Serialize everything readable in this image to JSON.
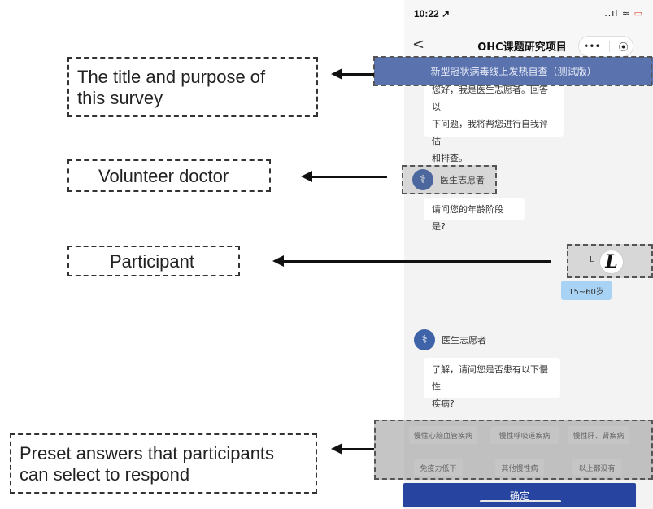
{
  "annotations": {
    "title": "The title and purpose of this survey",
    "doctor": "Volunteer doctor",
    "participant": "Participant",
    "preset": "Preset answers that participants can select to respond"
  },
  "phone": {
    "status_time": "10:22 ↗",
    "status_icons": "..ıl ≈",
    "battery": "▭",
    "back": "<",
    "title": "OHC课题研究项目",
    "menu": "•••",
    "record": "⦿",
    "banner": "新型冠状病毒线上发热自查（测试版）",
    "intro_lines": [
      "您好，我是医生志愿者。回答以",
      "下问题，我将帮您进行自我评估",
      "和排查。"
    ],
    "doctor_name_1": "医生志愿者",
    "question_1": "请问您的年龄阶段是?",
    "participant_letter": "L",
    "participant_avatar": "L",
    "answer_1": "15~60岁",
    "doctor_name_2": "医生志愿者",
    "question_2_lines": [
      "了解，请问您是否患有以下慢性",
      "疾病?"
    ],
    "chips": [
      "慢性心脑血管疾病",
      "慢性呼吸道疾病",
      "慢性肝、肾疾病",
      "免疫力低下",
      "其他慢性病",
      "以上都没有"
    ],
    "confirm": "确定"
  },
  "colors": {
    "banner": "#5a72ad",
    "avatar": "#3f63a8",
    "answer_bubble": "#a8d3f5",
    "confirm_button": "#2745a0"
  }
}
